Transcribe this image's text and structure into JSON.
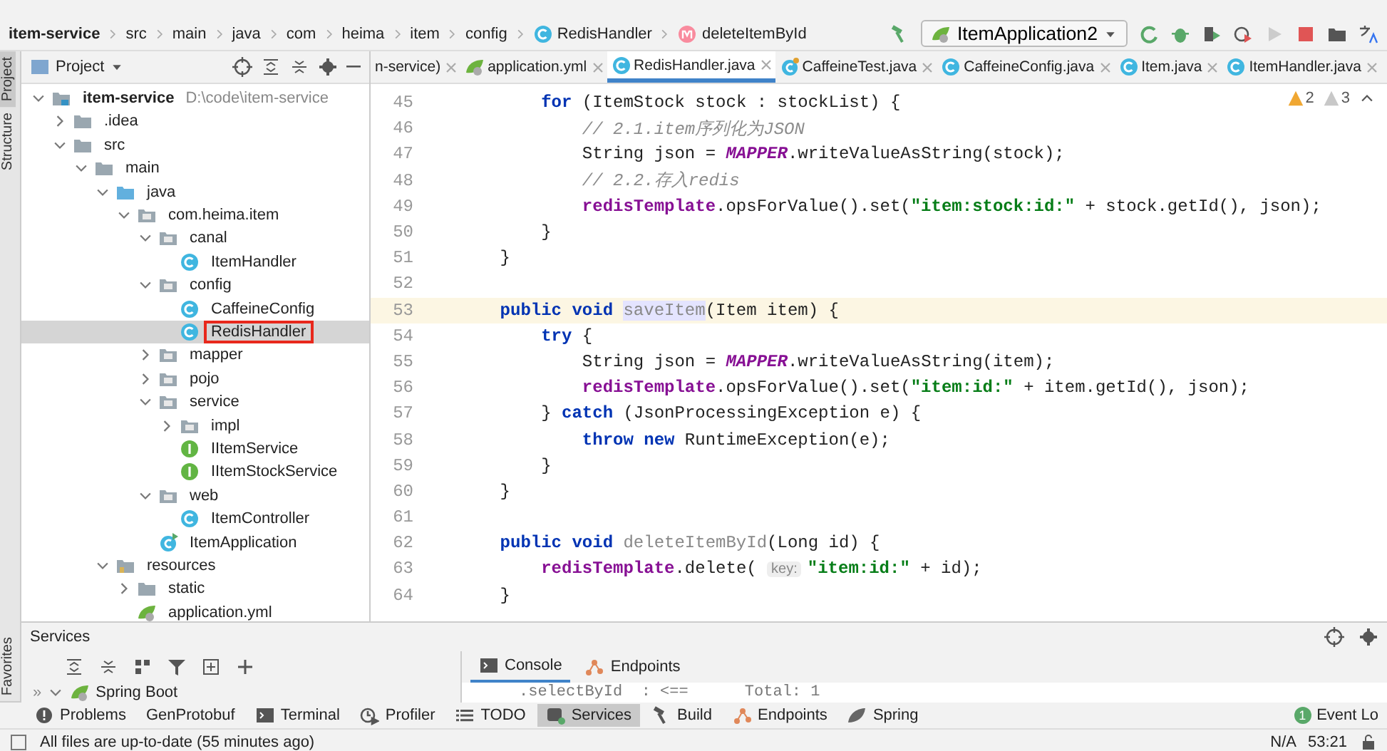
{
  "breadcrumbs": [
    {
      "label": "item-service",
      "kind": "module"
    },
    {
      "label": "src",
      "kind": "folder"
    },
    {
      "label": "main",
      "kind": "folder"
    },
    {
      "label": "java",
      "kind": "folder"
    },
    {
      "label": "com",
      "kind": "folder"
    },
    {
      "label": "heima",
      "kind": "folder"
    },
    {
      "label": "item",
      "kind": "folder"
    },
    {
      "label": "config",
      "kind": "folder"
    },
    {
      "label": "RedisHandler",
      "kind": "class"
    },
    {
      "label": "deleteItemById",
      "kind": "method"
    }
  ],
  "run_config": {
    "label": "ItemApplication2"
  },
  "side_strip": [
    {
      "label": "Project",
      "selected": true
    },
    {
      "label": "Structure",
      "selected": false
    }
  ],
  "side_strip_bottom": [
    {
      "label": "Favorites",
      "selected": false
    }
  ],
  "project_panel": {
    "title": "Project",
    "tree": [
      {
        "label": "item-service",
        "kind": "module",
        "hint": "D:\\code\\item-service",
        "expanded": true,
        "selected": false,
        "children": [
          {
            "label": ".idea",
            "kind": "folder",
            "expanded": false,
            "selected": false
          },
          {
            "label": "src",
            "kind": "folder",
            "expanded": true,
            "selected": false,
            "children": [
              {
                "label": "main",
                "kind": "folder",
                "expanded": true,
                "selected": false,
                "children": [
                  {
                    "label": "java",
                    "kind": "source",
                    "expanded": true,
                    "selected": false,
                    "children": [
                      {
                        "label": "com.heima.item",
                        "kind": "package",
                        "expanded": true,
                        "selected": false,
                        "children": [
                          {
                            "label": "canal",
                            "kind": "package",
                            "expanded": true,
                            "selected": false,
                            "children": [
                              {
                                "label": "ItemHandler",
                                "kind": "class",
                                "selected": false
                              }
                            ]
                          },
                          {
                            "label": "config",
                            "kind": "package",
                            "expanded": true,
                            "selected": false,
                            "children": [
                              {
                                "label": "CaffeineConfig",
                                "kind": "class",
                                "selected": false
                              },
                              {
                                "label": "RedisHandler",
                                "kind": "class",
                                "selected": true
                              }
                            ]
                          },
                          {
                            "label": "mapper",
                            "kind": "package",
                            "expanded": false,
                            "selected": false
                          },
                          {
                            "label": "pojo",
                            "kind": "package",
                            "expanded": false,
                            "selected": false
                          },
                          {
                            "label": "service",
                            "kind": "package",
                            "expanded": true,
                            "selected": false,
                            "children": [
                              {
                                "label": "impl",
                                "kind": "package",
                                "expanded": false,
                                "selected": false
                              },
                              {
                                "label": "IItemService",
                                "kind": "interface",
                                "selected": false
                              },
                              {
                                "label": "IItemStockService",
                                "kind": "interface",
                                "selected": false
                              }
                            ]
                          },
                          {
                            "label": "web",
                            "kind": "package",
                            "expanded": true,
                            "selected": false,
                            "children": [
                              {
                                "label": "ItemController",
                                "kind": "class",
                                "selected": false
                              }
                            ]
                          },
                          {
                            "label": "ItemApplication",
                            "kind": "app",
                            "selected": false
                          }
                        ]
                      }
                    ]
                  },
                  {
                    "label": "resources",
                    "kind": "resources",
                    "expanded": true,
                    "selected": false,
                    "children": [
                      {
                        "label": "static",
                        "kind": "folder",
                        "expanded": false,
                        "selected": false
                      },
                      {
                        "label": "application.yml",
                        "kind": "yml",
                        "selected": false
                      }
                    ]
                  }
                ]
              }
            ]
          }
        ]
      }
    ]
  },
  "editor_tabs": [
    {
      "label": "n-service)",
      "kind": "none",
      "selected": false
    },
    {
      "label": "application.yml",
      "kind": "yml",
      "selected": false
    },
    {
      "label": "RedisHandler.java",
      "kind": "class",
      "selected": true
    },
    {
      "label": "CaffeineTest.java",
      "kind": "test",
      "selected": false
    },
    {
      "label": "CaffeineConfig.java",
      "kind": "class",
      "selected": false
    },
    {
      "label": "Item.java",
      "kind": "class",
      "selected": false
    },
    {
      "label": "ItemHandler.java",
      "kind": "class",
      "selected": false
    }
  ],
  "inspections": [
    {
      "count": "2",
      "kind": "warning"
    },
    {
      "count": "3",
      "kind": "weak"
    }
  ],
  "code_lines": [
    {
      "number": "45",
      "current": false,
      "tokens": [
        {
          "kind": "keyword",
          "text": "        for"
        },
        {
          "kind": "plain",
          "text": " (ItemStock stock : stockList) {"
        }
      ]
    },
    {
      "number": "46",
      "current": false,
      "tokens": [
        {
          "kind": "comment",
          "text": "            // 2.1.item序列化为JSON"
        }
      ]
    },
    {
      "number": "47",
      "current": false,
      "tokens": [
        {
          "kind": "plain",
          "text": "            String json = "
        },
        {
          "kind": "static",
          "text": "MAPPER"
        },
        {
          "kind": "plain",
          "text": ".writeValueAsString(stock);"
        }
      ]
    },
    {
      "number": "48",
      "current": false,
      "tokens": [
        {
          "kind": "comment",
          "text": "            // 2.2.存入redis"
        }
      ]
    },
    {
      "number": "49",
      "current": false,
      "tokens": [
        {
          "kind": "field",
          "text": "            redisTemplate"
        },
        {
          "kind": "plain",
          "text": ".opsForValue().set("
        },
        {
          "kind": "string",
          "text": "\"item:stock:id:\""
        },
        {
          "kind": "plain",
          "text": " + stock.getId(), json);"
        }
      ]
    },
    {
      "number": "50",
      "current": false,
      "tokens": [
        {
          "kind": "plain",
          "text": "        }"
        }
      ]
    },
    {
      "number": "51",
      "current": false,
      "tokens": [
        {
          "kind": "plain",
          "text": "    }"
        }
      ]
    },
    {
      "number": "52",
      "current": false
    },
    {
      "number": "53",
      "current": true,
      "tokens": [
        {
          "kind": "keyword",
          "text": "    public void "
        },
        {
          "kind": "usage",
          "text": "saveItem"
        },
        {
          "kind": "plain",
          "text": "(Item item) {"
        }
      ]
    },
    {
      "number": "54",
      "current": false,
      "tokens": [
        {
          "kind": "keyword",
          "text": "        try"
        },
        {
          "kind": "plain",
          "text": " {"
        }
      ]
    },
    {
      "number": "55",
      "current": false,
      "tokens": [
        {
          "kind": "plain",
          "text": "            String json = "
        },
        {
          "kind": "static",
          "text": "MAPPER"
        },
        {
          "kind": "plain",
          "text": ".writeValueAsString(item);"
        }
      ]
    },
    {
      "number": "56",
      "current": false,
      "tokens": [
        {
          "kind": "field",
          "text": "            redisTemplate"
        },
        {
          "kind": "plain",
          "text": ".opsForValue().set("
        },
        {
          "kind": "string",
          "text": "\"item:id:\""
        },
        {
          "kind": "plain",
          "text": " + item.getId(), json);"
        }
      ]
    },
    {
      "number": "57",
      "current": false,
      "tokens": [
        {
          "kind": "plain",
          "text": "        } "
        },
        {
          "kind": "keyword",
          "text": "catch"
        },
        {
          "kind": "plain",
          "text": " (JsonProcessingException e) {"
        }
      ]
    },
    {
      "number": "58",
      "current": false,
      "tokens": [
        {
          "kind": "keyword",
          "text": "            throw new"
        },
        {
          "kind": "plain",
          "text": " RuntimeException(e);"
        }
      ]
    },
    {
      "number": "59",
      "current": false,
      "tokens": [
        {
          "kind": "plain",
          "text": "        }"
        }
      ]
    },
    {
      "number": "60",
      "current": false,
      "tokens": [
        {
          "kind": "plain",
          "text": "    }"
        }
      ]
    },
    {
      "number": "61",
      "current": false
    },
    {
      "number": "62",
      "current": false,
      "tokens": [
        {
          "kind": "keyword",
          "text": "    public void "
        },
        {
          "kind": "unused",
          "text": "deleteItemById"
        },
        {
          "kind": "plain",
          "text": "(Long id) {"
        }
      ]
    },
    {
      "number": "63",
      "current": false,
      "tokens": [
        {
          "kind": "field",
          "text": "        redisTemplate"
        },
        {
          "kind": "plain",
          "text": ".delete( "
        },
        {
          "kind": "hint",
          "text": "key:"
        },
        {
          "kind": "string",
          "text": "\"item:id:\""
        },
        {
          "kind": "plain",
          "text": " + id);"
        }
      ]
    },
    {
      "number": "64",
      "current": false,
      "tokens": [
        {
          "kind": "plain",
          "text": "    }"
        }
      ]
    }
  ],
  "services": {
    "title": "Services",
    "expand_hint": "»",
    "tree_row": "Spring Boot",
    "tabs": [
      {
        "label": "Console",
        "kind": "console",
        "selected": true
      },
      {
        "label": "Endpoints",
        "kind": "endpoints",
        "selected": false
      }
    ],
    "console_line": ".selectById  : <==      Total: 1"
  },
  "tool_tabs": [
    {
      "label": "Problems",
      "kind": "problems",
      "selected": false
    },
    {
      "label": "GenProtobuf",
      "kind": "none",
      "selected": false
    },
    {
      "label": "Terminal",
      "kind": "terminal",
      "selected": false
    },
    {
      "label": "Profiler",
      "kind": "profiler",
      "selected": false
    },
    {
      "label": "TODO",
      "kind": "todo",
      "selected": false
    },
    {
      "label": "Services",
      "kind": "services",
      "selected": true
    },
    {
      "label": "Build",
      "kind": "build",
      "selected": false
    },
    {
      "label": "Endpoints",
      "kind": "endpoints",
      "selected": false
    },
    {
      "label": "Spring",
      "kind": "spring",
      "selected": false
    }
  ],
  "event_log": {
    "label": "Event Lo",
    "badge": "1"
  },
  "status_bar": {
    "message": "All files are up-to-date (55 minutes ago)",
    "encoding": "N/A",
    "position": "53:21"
  }
}
